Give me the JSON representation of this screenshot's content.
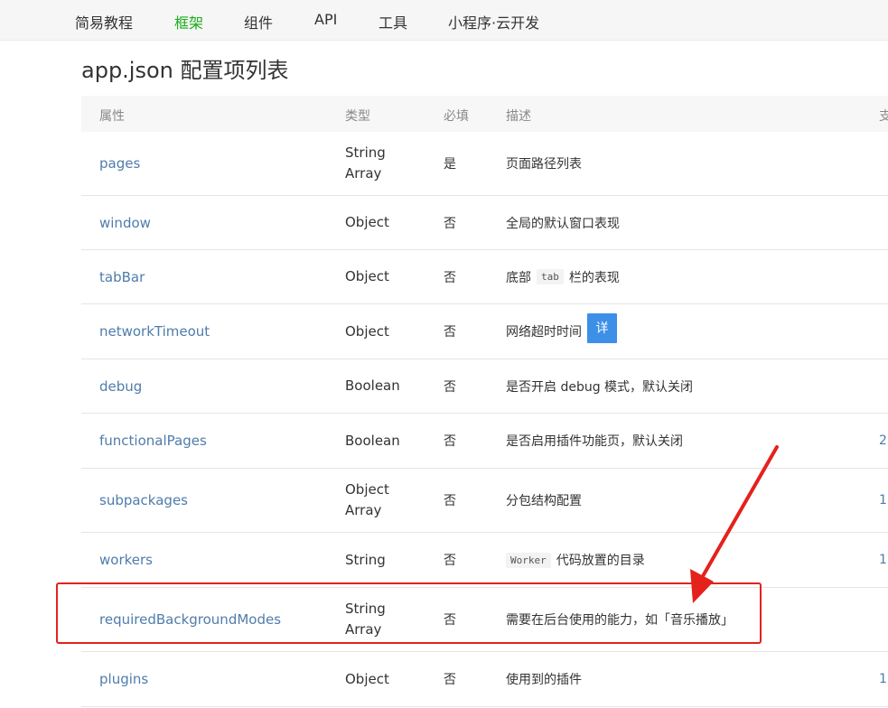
{
  "nav": {
    "items": [
      {
        "label": "简易教程",
        "active": false
      },
      {
        "label": "框架",
        "active": true
      },
      {
        "label": "组件",
        "active": false
      },
      {
        "label": "API",
        "active": false
      },
      {
        "label": "工具",
        "active": false
      },
      {
        "label": "小程序·云开发",
        "active": false
      }
    ],
    "active_color": "#1aad19"
  },
  "page": {
    "title": "app.json 配置项列表"
  },
  "table": {
    "headers": {
      "attr": "属性",
      "type": "类型",
      "required": "必填",
      "desc": "描述",
      "version": "支"
    },
    "rows": [
      {
        "attr": "pages",
        "type": [
          "String",
          "Array"
        ],
        "required": "是",
        "desc": "页面路径列表",
        "version": ""
      },
      {
        "attr": "window",
        "type": [
          "Object"
        ],
        "required": "否",
        "desc": "全局的默认窗口表现",
        "version": ""
      },
      {
        "attr": "tabBar",
        "type": [
          "Object"
        ],
        "required": "否",
        "desc_before": "底部",
        "desc_code": "tab",
        "desc_after": "栏的表现",
        "version": ""
      },
      {
        "attr": "networkTimeout",
        "type": [
          "Object"
        ],
        "required": "否",
        "desc": "网络超时时间",
        "detail_label": "详",
        "version": ""
      },
      {
        "attr": "debug",
        "type": [
          "Boolean"
        ],
        "required": "否",
        "desc": "是否开启 debug 模式，默认关闭",
        "version": ""
      },
      {
        "attr": "functionalPages",
        "type": [
          "Boolean"
        ],
        "required": "否",
        "desc": "是否启用插件功能页，默认关闭",
        "version": "2."
      },
      {
        "attr": "subpackages",
        "type": [
          "Object",
          "Array"
        ],
        "required": "否",
        "desc": "分包结构配置",
        "version": "1."
      },
      {
        "attr": "workers",
        "type": [
          "String"
        ],
        "required": "否",
        "desc_code": "Worker",
        "desc_after": "代码放置的目录",
        "version": "1."
      },
      {
        "attr": "requiredBackgroundModes",
        "type": [
          "String",
          "Array"
        ],
        "required": "否",
        "desc": "需要在后台使用的能力，如「音乐播放」",
        "version": ""
      },
      {
        "attr": "plugins",
        "type": [
          "Object"
        ],
        "required": "否",
        "desc": "使用到的插件",
        "version": "1."
      }
    ]
  },
  "annotation": {
    "color": "#e5211c"
  }
}
